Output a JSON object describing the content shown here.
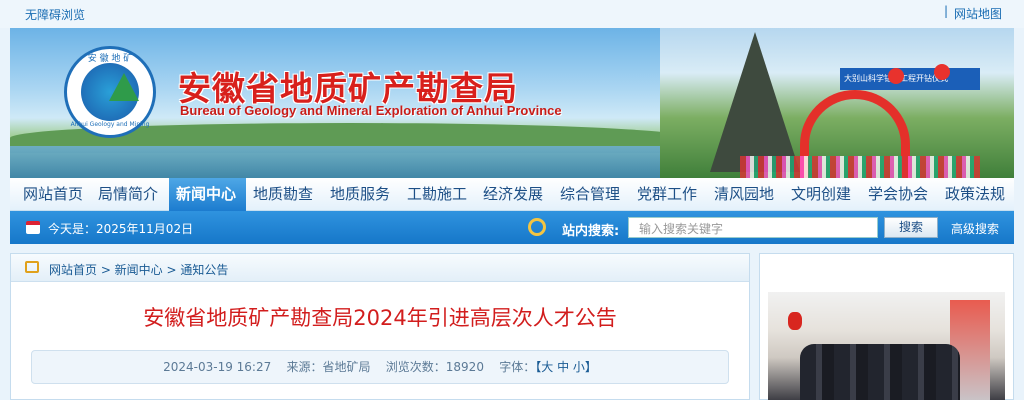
{
  "topbar": {
    "accessibility_label": "无障碍浏览",
    "sitemap_label": "网站地图",
    "separator": "|"
  },
  "banner": {
    "title_cn": "安徽省地质矿产勘查局",
    "title_en": "Bureau of Geology and Mineral Exploration of Anhui Province",
    "logo_text_cn": "安 徽 地 矿",
    "logo_text_en": "Anhui Geology and Mining",
    "photo_banner_text": "大别山科学钻探工程开钻仪式"
  },
  "nav": {
    "items": [
      "网站首页",
      "局情简介",
      "新闻中心",
      "地质勘查",
      "地质服务",
      "工勘施工",
      "经济发展",
      "综合管理",
      "党群工作",
      "清风园地",
      "文明创建",
      "学会协会",
      "政策法规"
    ],
    "active_index": 2
  },
  "datebar": {
    "date_text": "今天是：2025年11月02日",
    "search_label": "站内搜索:",
    "search_placeholder": "输入搜索关键字",
    "search_button": "搜索",
    "advanced_search": "高级搜索"
  },
  "breadcrumb": {
    "text": "网站首页 > 新闻中心 > 通知公告"
  },
  "article": {
    "title": "安徽省地质矿产勘查局2024年引进高层次人才公告",
    "date": "2024-03-19 16:27",
    "source_label": "来源：省地矿局",
    "views_label": "浏览次数：18920",
    "font_label": "字体：",
    "font_sizes": "【大 中 小】"
  },
  "colors": {
    "accent_blue": "#1677c9",
    "title_red": "#d21d1d",
    "nav_text": "#1d4f86"
  }
}
